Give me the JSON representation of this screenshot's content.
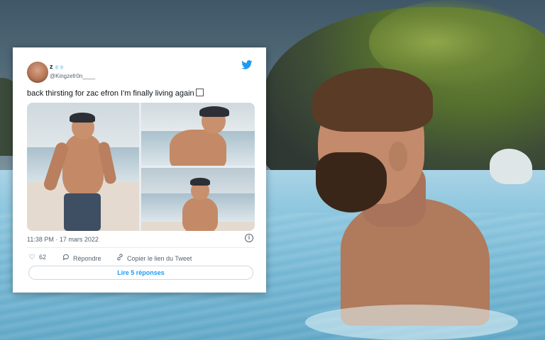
{
  "tweet": {
    "display_name": "z",
    "handle": "@Kingzefr0n____",
    "text": "back thirsting for zac efron I'm finally living again",
    "timestamp": "11:38 PM · 17 mars 2022",
    "likes": "62",
    "reply_label": "Répondre",
    "copy_link_label": "Copier le lien du Tweet",
    "read_replies_label": "Lire 5 réponses",
    "info_glyph": "i"
  },
  "colors": {
    "twitter_blue": "#1d9bf0",
    "text_primary": "#0f1419",
    "text_secondary": "#536471"
  },
  "icons": {
    "brand": "twitter-bird-icon",
    "like": "heart-icon",
    "reply": "speech-bubble-icon",
    "copy": "link-icon",
    "info": "info-icon"
  }
}
